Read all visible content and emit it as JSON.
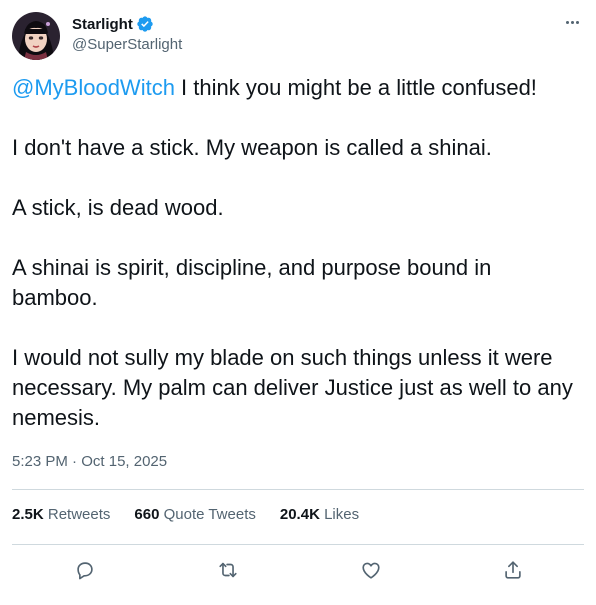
{
  "author": {
    "display_name": "Starlight",
    "handle": "@SuperStarlight",
    "verified": true,
    "avatar_icon": "avatar-starlight"
  },
  "tweet": {
    "mention": "@MyBloodWitch",
    "paragraphs": [
      " I think you might be a little confused!",
      "I don't have a stick. My weapon is called a shinai.",
      "A stick, is dead wood.",
      "A shinai is spirit, discipline, and purpose bound in bamboo.",
      "I would not sully my blade on such things unless it were necessary.  My palm can deliver Justice just as well to any nemesis."
    ],
    "time": "5:23 PM",
    "separator": " · ",
    "date": "Oct 15, 2025"
  },
  "stats": {
    "retweets": {
      "count": "2.5K",
      "label": " Retweets"
    },
    "quotes": {
      "count": "660",
      "label": " Quote Tweets"
    },
    "likes": {
      "count": "20.4K",
      "label": " Likes"
    }
  },
  "actions": [
    "reply-icon",
    "retweet-icon",
    "like-icon",
    "share-icon"
  ],
  "colors": {
    "accent": "#1d9bf0",
    "text": "#0f1419",
    "secondary": "#536471",
    "divider": "#cfd9de"
  }
}
